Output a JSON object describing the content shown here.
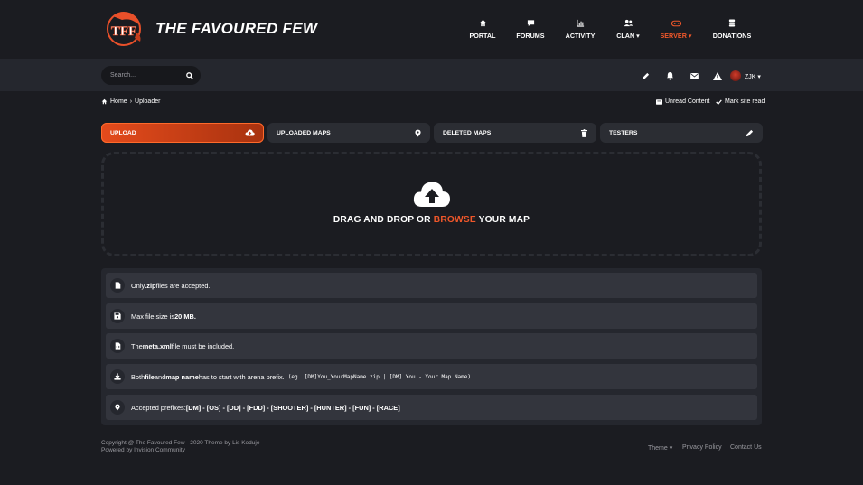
{
  "header": {
    "site_title": "THE FAVOURED FEW",
    "nav": [
      {
        "label": "PORTAL",
        "icon": "home-icon"
      },
      {
        "label": "FORUMS",
        "icon": "chat-icon"
      },
      {
        "label": "ACTIVITY",
        "icon": "activity-chart-icon"
      },
      {
        "label": "CLAN ▾",
        "icon": "users-icon"
      },
      {
        "label": "SERVER ▾",
        "icon": "gamepad-icon",
        "active": true
      },
      {
        "label": "DONATIONS",
        "icon": "donate-icon"
      }
    ],
    "accent_color": "#f0572a"
  },
  "userbar": {
    "search_placeholder": "Search...",
    "username": "ZJK ▾"
  },
  "breadcrumb": {
    "home": "Home",
    "separator": "›",
    "current": "Uploader"
  },
  "page_actions": {
    "unread": "Unread Content",
    "mark_read": "Mark site read"
  },
  "tabs": [
    {
      "label": "UPLOAD",
      "icon": "cloud-upload-icon",
      "active": true
    },
    {
      "label": "UPLOADED MAPS",
      "icon": "map-pin-icon"
    },
    {
      "label": "DELETED MAPS",
      "icon": "trash-icon"
    },
    {
      "label": "TESTERS",
      "icon": "wrench-icon"
    }
  ],
  "dropzone": {
    "text_before": "DRAG AND DROP OR ",
    "browse": "BROWSE",
    "text_after": " YOUR MAP"
  },
  "info": {
    "row1": {
      "pre": "Only ",
      "bold": ".zip",
      "post": " files are accepted."
    },
    "row2": {
      "pre": "Max file size is ",
      "bold": "20 MB."
    },
    "row3": {
      "pre": "The ",
      "bold": "meta.xml",
      "post": " file must be included."
    },
    "row4": {
      "pre": "Both ",
      "bold1": "file",
      "mid1": " and ",
      "bold2": "map name",
      "mid2": " has to start with arena prefix.",
      "code": "(eg. [DM]You_YourMapName.zip | [DM] You - Your Map Name)"
    },
    "row5": {
      "pre": "Accepted prefixes: ",
      "bold": "[DM] - [OS] - [DD] - [FDD] - [SHOOTER] - [HUNTER] - [FUN] - [RACE]"
    }
  },
  "footer": {
    "copyright": "Copyright @ The Favoured Few - 2020 Theme by Lis Koduje",
    "powered": "Powered by Invision Community",
    "theme": "Theme ▾",
    "privacy": "Privacy Policy",
    "contact": "Contact Us"
  }
}
